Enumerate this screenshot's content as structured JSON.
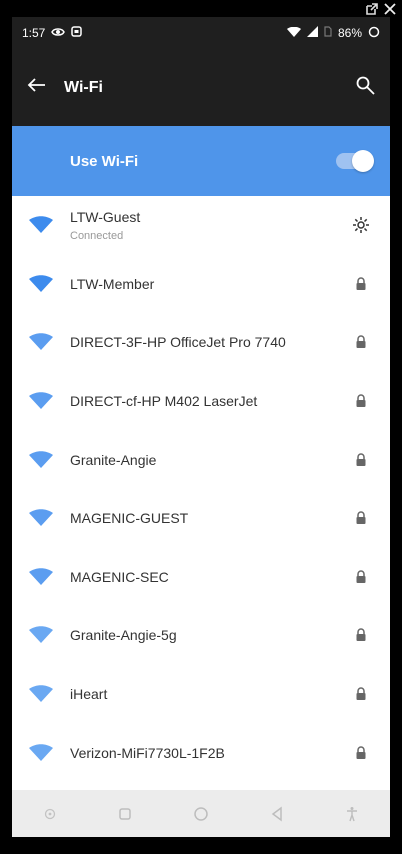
{
  "status": {
    "time": "1:57",
    "battery": "86%"
  },
  "appbar": {
    "title": "Wi-Fi"
  },
  "wifi_toggle": {
    "label": "Use Wi-Fi",
    "enabled": true
  },
  "networks": [
    {
      "name": "LTW-Guest",
      "status": "Connected",
      "trailing": "gear-icon",
      "signal": "strong"
    },
    {
      "name": "LTW-Member",
      "status": "",
      "trailing": "lock-icon",
      "signal": "strong"
    },
    {
      "name": "DIRECT-3F-HP OfficeJet Pro 7740",
      "status": "",
      "trailing": "lock-icon",
      "signal": "medium"
    },
    {
      "name": "DIRECT-cf-HP M402 LaserJet",
      "status": "",
      "trailing": "lock-icon",
      "signal": "medium"
    },
    {
      "name": "Granite-Angie",
      "status": "",
      "trailing": "lock-icon",
      "signal": "medium"
    },
    {
      "name": "MAGENIC-GUEST",
      "status": "",
      "trailing": "lock-icon",
      "signal": "medium"
    },
    {
      "name": "MAGENIC-SEC",
      "status": "",
      "trailing": "lock-icon",
      "signal": "medium"
    },
    {
      "name": "Granite-Angie-5g",
      "status": "",
      "trailing": "lock-icon",
      "signal": "weak"
    },
    {
      "name": "iHeart",
      "status": "",
      "trailing": "lock-icon",
      "signal": "weak"
    },
    {
      "name": "Verizon-MiFi7730L-1F2B",
      "status": "",
      "trailing": "lock-icon",
      "signal": "weak"
    }
  ],
  "colors": {
    "accent": "#4f95ea",
    "bar": "#1f1f1f",
    "text": "#333333"
  }
}
